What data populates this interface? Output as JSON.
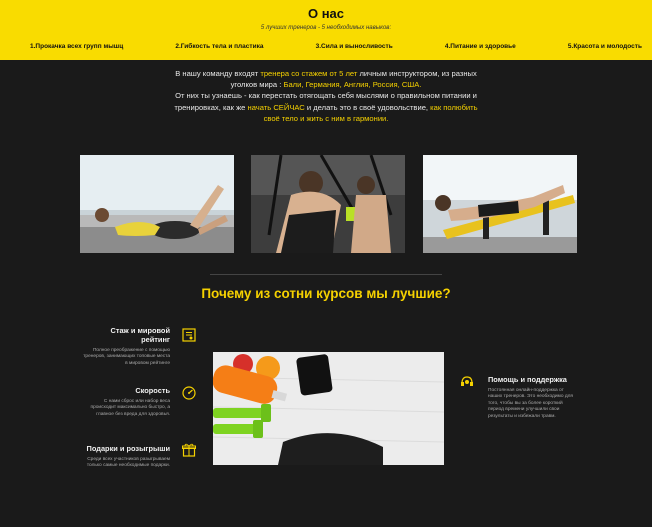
{
  "header": {
    "title": "О нас",
    "subtitle": "5 лучших тренеров - 5 необходимых навыков:",
    "skills": [
      "1.Прокачка всех групп мышц",
      "2.Гибкость тела и пластика",
      "3.Сила и выносливость",
      "4.Питание и здоровье",
      "5.Красота и молодость"
    ],
    "bg_color": "#f9dc00"
  },
  "intro": {
    "p1_a": "В нашу команду входят ",
    "p1_hl": "тренера со стажем от 5 лет",
    "p1_b": " личным инструктором, из разных уголков мира : ",
    "p1_hl2": "Бали, Германия, Англия, Россия, США.",
    "p2_a": "От них ты узнаешь - как перестать отягощать себя мыслями о правильном питании и тренировках, как же ",
    "p2_hl": "начать СЕЙЧАС",
    "p2_b": " и делать это в своё удовольствие, ",
    "p2_hl2": "как полюбить своё тело и жить с ним в гармонии.",
    "accent_color": "#f5d100"
  },
  "photos": [
    {
      "icon": "photo-woman-situps"
    },
    {
      "icon": "photo-trx-training"
    },
    {
      "icon": "photo-bench-exercise"
    }
  ],
  "why": {
    "title": "Почему из сотни курсов мы лучшие?"
  },
  "features": [
    {
      "title": "Стаж и мировой рейтинг",
      "text": "Полное преображение с помощью тренеров, занимающих топовые места в мировом рейтинге",
      "icon": "certificate-icon"
    },
    {
      "title": "Скорость",
      "text": "С нами сброс или набор веса происходит максимально быстро, а главное без вреда для здоровья.",
      "icon": "speedometer-icon"
    },
    {
      "title": "Подарки и розыгрыши",
      "text": "Среди всех участников разыгрываем только самые необходимые подарки.",
      "icon": "gift-icon"
    },
    {
      "title": "Помощь и поддержка",
      "text": "Постоянная онлайн-поддержка от наших тренеров. Это необходимо для того, чтобы вы за более короткий период времени улучшили свои результаты и избежали травм.",
      "icon": "support-icon"
    }
  ],
  "center_image": {
    "icon": "fitness-items-photo"
  }
}
